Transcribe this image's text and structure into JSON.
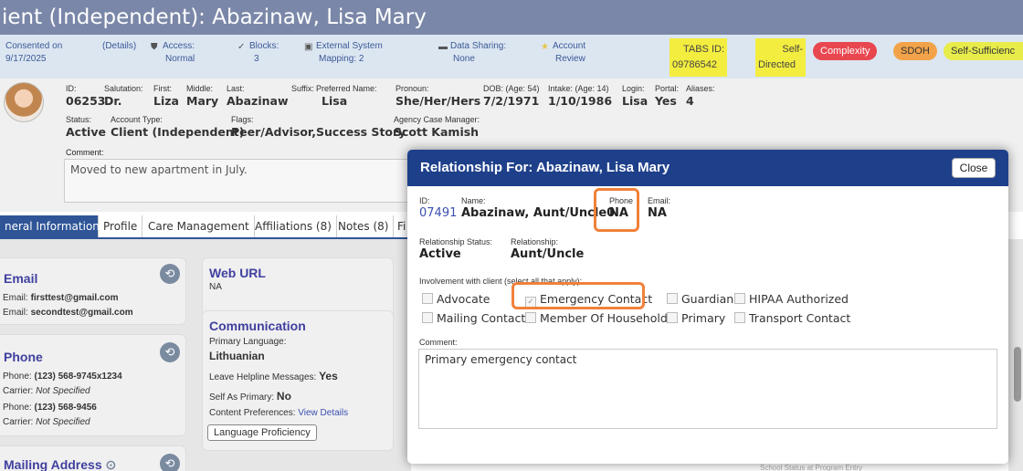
{
  "title": "ient (Independent): Abazinaw, Lisa Mary",
  "strip": {
    "consented_label": "Consented on",
    "consented_date": "9/17/2025",
    "details": "(Details)",
    "access_label": "Access:",
    "access_value": "Normal",
    "blocks_label": "Blocks:",
    "blocks_value": "3",
    "external_label": "External System",
    "external_value": "Mapping: 2",
    "sharing_label": "Data Sharing:",
    "sharing_value": "None",
    "account_label": "Account",
    "account_value": "Review",
    "tabs_label": "TABS ID:",
    "tabs_value": "09786542",
    "self_label": "Self-",
    "self_value": "Directed",
    "pill_complexity": "Complexity",
    "pill_sdoh": "SDOH",
    "pill_self": "Self-Sufficienc"
  },
  "client": {
    "id_label": "ID:",
    "id": "06253",
    "salutation_label": "Salutation:",
    "salutation": "Dr.",
    "first_label": "First:",
    "first": "Liza",
    "middle_label": "Middle:",
    "middle": "Mary",
    "last_label": "Last:",
    "last": "Abazinaw",
    "suffix_label": "Suffix:",
    "preferred_label": "Preferred Name:",
    "preferred": "Lisa",
    "pronoun_label": "Pronoun:",
    "pronoun": "She/Her/Hers",
    "dob_label": "DOB: (Age: 54)",
    "dob": "7/2/1971",
    "intake_label": "Intake: (Age: 14)",
    "intake": "1/10/1986",
    "login_label": "Login:",
    "login": "Lisa",
    "portal_label": "Portal:",
    "portal": "Yes",
    "aliases_label": "Aliases:",
    "aliases": "4",
    "status_label": "Status:",
    "status": "Active",
    "type_label": "Account Type:",
    "type": "Client (Independent)",
    "flags_label": "Flags:",
    "flags": "Peer/Advisor,Success Story",
    "manager_label": "Agency Case Manager:",
    "manager": "Scott Kamish",
    "comment_label": "Comment:",
    "comment": "Moved to new apartment in July."
  },
  "tabs": [
    "neral Information",
    "Profile",
    "Care Management",
    "Affiliations (8)",
    "Notes (8)",
    "Fi"
  ],
  "left": {
    "email_title": "Email",
    "email1_label": "Email:",
    "email1": "firsttest@gmail.com",
    "email2_label": "Email:",
    "email2": "secondtest@gmail.com",
    "phone_title": "Phone",
    "phone1_label": "Phone:",
    "phone1": "(123) 568-9745x1234",
    "carrier1_label": "Carrier:",
    "carrier1": "Not Specified",
    "phone2_label": "Phone:",
    "phone2": "(123) 568-9456",
    "carrier2_label": "Carrier:",
    "carrier2": "Not Specified",
    "mailing_title": "Mailing Address",
    "web_title": "Web URL",
    "web_value": "NA",
    "comm_title": "Communication",
    "lang_label": "Primary Language:",
    "lang": "Lithuanian",
    "helpline_label": "Leave Helpline Messages:",
    "helpline": "Yes",
    "selfprimary_label": "Self As Primary:",
    "selfprimary": "No",
    "content_label": "Content Preferences:",
    "content_link": "View Details",
    "lang_prof": "Language Proficiency"
  },
  "modal": {
    "title": "Relationship For: Abazinaw, Lisa Mary",
    "close": "Close",
    "id_label": "ID:",
    "id": "07491",
    "name_label": "Name:",
    "name": "Abazinaw, Aunt/Uncle0",
    "phone_label": "Phone",
    "phone": "NA",
    "email_label": "Email:",
    "email": "NA",
    "relstatus_label": "Relationship Status:",
    "relstatus": "Active",
    "rel_label": "Relationship:",
    "rel": "Aunt/Uncle",
    "involvement_label": "Involvement with client (select all that apply):",
    "checks": [
      "Advocate",
      "Emergency Contact",
      "Guardian",
      "HIPAA Authorized",
      "Mailing Contact",
      "Member Of Household",
      "Primary",
      "Transport Contact"
    ],
    "comment_label": "Comment:",
    "comment": "Primary emergency contact"
  },
  "footnote": "School Status at Program Entry",
  "colors": {
    "header": "#7a87a8",
    "modal_header": "#1e3f8a",
    "highlight": "#f0813a",
    "strip": "#dce6f1"
  }
}
